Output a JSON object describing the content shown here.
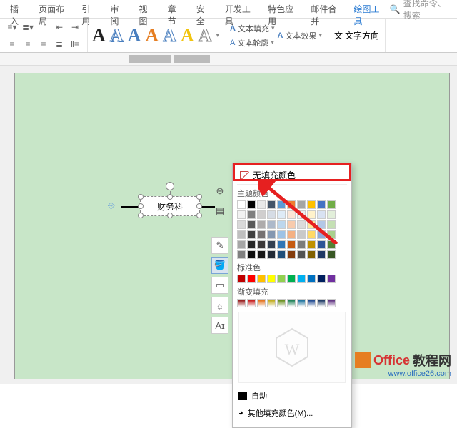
{
  "tabs": {
    "t0": "插入",
    "t1": "页面布局",
    "t2": "引用",
    "t3": "审阅",
    "t4": "视图",
    "t5": "章节",
    "t6": "安全",
    "t7": "开发工具",
    "t8": "特色应用",
    "t9": "邮件合并",
    "t10": "绘图工具"
  },
  "search_placeholder": "查找命令、搜索",
  "txtfill": "文本填充",
  "txtoutline": "文本轮廓",
  "txteffect": "文本效果",
  "txtdir": "文字方向",
  "shape_text": "财务科",
  "popup": {
    "nofill": "无填充颜色",
    "theme": "主题颜色",
    "standard": "标准色",
    "gradient": "渐变填充",
    "auto": "自动",
    "more": "其他填充颜色(M)..."
  },
  "theme_colors": [
    [
      "#ffffff",
      "#000000",
      "#e8e8e8",
      "#445569",
      "#5b9bd5",
      "#ed7d31",
      "#a5a5a5",
      "#ffc000",
      "#4472c4",
      "#70ad47"
    ],
    [
      "#f2f2f2",
      "#7f7f7f",
      "#d0cece",
      "#d6dce5",
      "#deebf7",
      "#fbe5d6",
      "#ededed",
      "#fff2cc",
      "#d9e2f3",
      "#e2efda"
    ],
    [
      "#d9d9d9",
      "#595959",
      "#aeabab",
      "#adb9ca",
      "#bdd7ee",
      "#f8cbad",
      "#dbdbdb",
      "#ffe699",
      "#b4c7e7",
      "#c5e0b4"
    ],
    [
      "#bfbfbf",
      "#404040",
      "#757171",
      "#8497b0",
      "#9dc3e6",
      "#f4b183",
      "#c9c9c9",
      "#ffd966",
      "#8faadc",
      "#a9d18e"
    ],
    [
      "#a6a6a6",
      "#262626",
      "#3b3838",
      "#333f50",
      "#2e75b6",
      "#c55a11",
      "#7b7b7b",
      "#bf9000",
      "#2f5597",
      "#548235"
    ],
    [
      "#808080",
      "#0d0d0d",
      "#171717",
      "#222a35",
      "#1f4e79",
      "#843c0c",
      "#525252",
      "#806000",
      "#203864",
      "#385724"
    ]
  ],
  "standard_colors": [
    "#c00000",
    "#ff0000",
    "#ffc000",
    "#ffff00",
    "#92d050",
    "#00b050",
    "#00b0f0",
    "#0070c0",
    "#002060",
    "#7030a0"
  ],
  "gradient_colors": [
    "#8b0000",
    "#c00000",
    "#e06000",
    "#b8a000",
    "#548000",
    "#007040",
    "#006090",
    "#003080",
    "#002050",
    "#4b1870"
  ],
  "watermark": {
    "brand": "Office",
    "brand2": "教程网",
    "url": "www.office26.com"
  }
}
